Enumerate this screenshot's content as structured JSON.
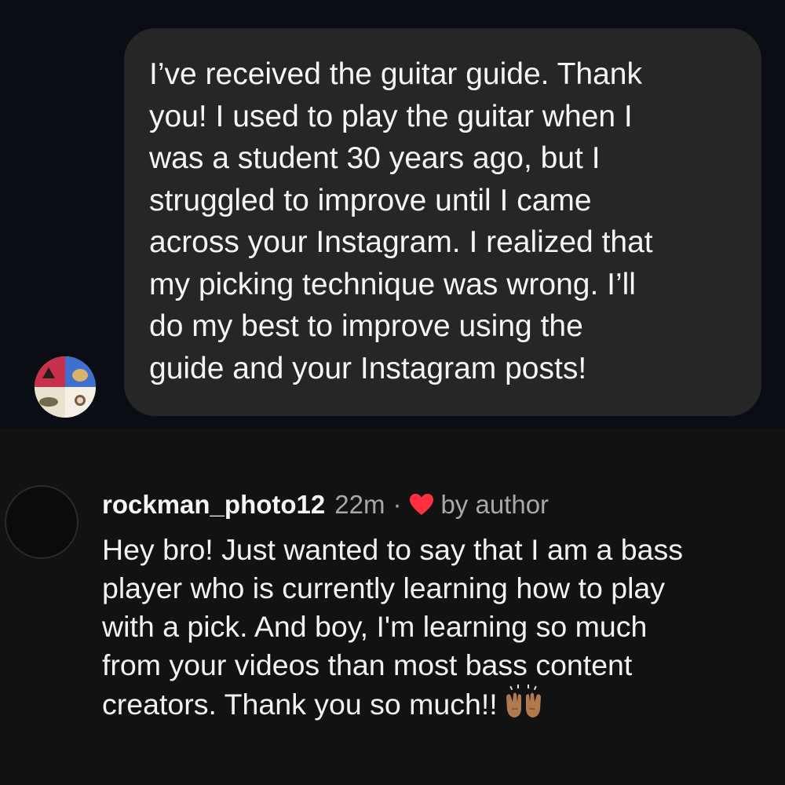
{
  "dm": {
    "message": "I’ve received the guitar guide. Thank\nyou! I used to play the guitar when I\nwas a student 30 years ago, but I\nstruggled to improve until I came\nacross your Instagram. I realized that\nmy picking technique was wrong. I’ll\ndo my best to improve using the\nguide and your Instagram posts!"
  },
  "comment": {
    "username": "rockman_photo12",
    "time": "22m",
    "separator": "·",
    "liked_label": "by author",
    "heart_color": "#ff3040",
    "text": "Hey bro! Just wanted to say that I am a bass\nplayer who is currently learning how to play\nwith a pick. And boy, I'm learning so much\nfrom your videos than most bass content\ncreators. Thank you so much!!",
    "emoji": "raising-hands-emoji"
  },
  "colors": {
    "dm_background": "#0a0d14",
    "bubble": "#262626",
    "comment_background": "#121212",
    "secondary_text": "#a8a8a8"
  }
}
